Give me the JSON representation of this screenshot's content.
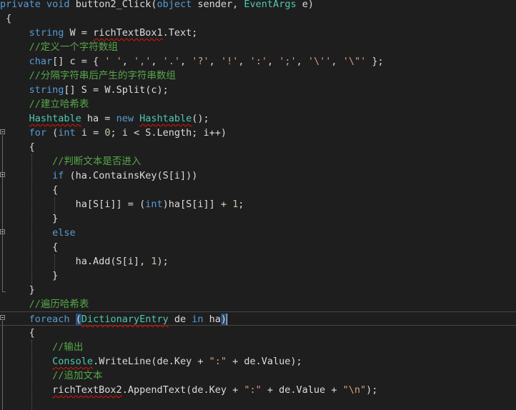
{
  "editor": {
    "theme": {
      "background": "#1e1e1e",
      "keyword": "#569cd6",
      "type": "#4ec9b0",
      "comment": "#57a64a",
      "string": "#d69d85",
      "number": "#b5cea8",
      "text": "#dcdcdc"
    },
    "lines": [
      [
        [
          "kw",
          "private"
        ],
        [
          "pl",
          " "
        ],
        [
          "kw",
          "void"
        ],
        [
          "pl",
          " button2_Click("
        ],
        [
          "kw",
          "object"
        ],
        [
          "pl",
          " sender, "
        ],
        [
          "ty",
          "EventArgs"
        ],
        [
          "pl",
          " e)"
        ]
      ],
      [
        [
          "pl",
          " {"
        ]
      ],
      [
        [
          "pl",
          "     "
        ],
        [
          "kw",
          "string"
        ],
        [
          "pl",
          " W = "
        ],
        [
          "pl",
          "richTextBox1",
          "sq"
        ],
        [
          "pl",
          ".Text;"
        ]
      ],
      [
        [
          "pl",
          "     "
        ],
        [
          "cm",
          "//定义一个字符数组"
        ]
      ],
      [
        [
          "pl",
          "     "
        ],
        [
          "kw",
          "char"
        ],
        [
          "pl",
          "[] c = { "
        ],
        [
          "st",
          "' '"
        ],
        [
          "pl",
          ", "
        ],
        [
          "st",
          "','"
        ],
        [
          "pl",
          ", "
        ],
        [
          "st",
          "'.'"
        ],
        [
          "pl",
          ", "
        ],
        [
          "st",
          "'?'"
        ],
        [
          "pl",
          ", "
        ],
        [
          "st",
          "'!'"
        ],
        [
          "pl",
          ", "
        ],
        [
          "st",
          "':'"
        ],
        [
          "pl",
          ", "
        ],
        [
          "st",
          "';'"
        ],
        [
          "pl",
          ", "
        ],
        [
          "st",
          "'\\''"
        ],
        [
          "pl",
          ", "
        ],
        [
          "st",
          "'\\\"'"
        ],
        [
          "pl",
          " };"
        ]
      ],
      [
        [
          "pl",
          "     "
        ],
        [
          "cm",
          "//分隔字符串后产生的字符串数组"
        ]
      ],
      [
        [
          "pl",
          "     "
        ],
        [
          "kw",
          "string"
        ],
        [
          "pl",
          "[] S = W.Split(c);"
        ]
      ],
      [
        [
          "pl",
          "     "
        ],
        [
          "cm",
          "//建立哈希表"
        ]
      ],
      [
        [
          "pl",
          "     "
        ],
        [
          "ty",
          "Hashtable",
          "sq"
        ],
        [
          "pl",
          " ha = "
        ],
        [
          "kw",
          "new"
        ],
        [
          "pl",
          " "
        ],
        [
          "ty",
          "Hashtable",
          "sq"
        ],
        [
          "pl",
          "();"
        ]
      ],
      [
        [
          "pl",
          "     "
        ],
        [
          "kw",
          "for"
        ],
        [
          "pl",
          " ("
        ],
        [
          "kw",
          "int"
        ],
        [
          "pl",
          " i = "
        ],
        [
          "nm",
          "0"
        ],
        [
          "pl",
          "; i < S.Length; i++)"
        ]
      ],
      [
        [
          "pl",
          "     {"
        ]
      ],
      [
        [
          "pl",
          "         "
        ],
        [
          "cm",
          "//判断文本是否进入"
        ]
      ],
      [
        [
          "pl",
          "         "
        ],
        [
          "kw",
          "if"
        ],
        [
          "pl",
          " (ha.ContainsKey(S[i]))"
        ]
      ],
      [
        [
          "pl",
          "         {"
        ]
      ],
      [
        [
          "pl",
          "             ha[S[i]] = ("
        ],
        [
          "kw",
          "int"
        ],
        [
          "pl",
          ")ha[S[i]] + "
        ],
        [
          "nm",
          "1"
        ],
        [
          "pl",
          ";"
        ]
      ],
      [
        [
          "pl",
          "         }"
        ]
      ],
      [
        [
          "pl",
          "         "
        ],
        [
          "kw",
          "else"
        ]
      ],
      [
        [
          "pl",
          "         {"
        ]
      ],
      [
        [
          "pl",
          "             ha.Add(S[i], "
        ],
        [
          "nm",
          "1"
        ],
        [
          "pl",
          ");"
        ]
      ],
      [
        [
          "pl",
          "         }"
        ]
      ],
      [
        [
          "pl",
          "     }"
        ]
      ],
      [
        [
          "pl",
          "     "
        ],
        [
          "cm",
          "//遍历哈希表"
        ]
      ],
      [
        [
          "pl",
          "     "
        ],
        [
          "kw",
          "foreach"
        ],
        [
          "pl",
          " "
        ],
        [
          "pl",
          "(",
          "hl"
        ],
        [
          "ty",
          "DictionaryEntry",
          "sq"
        ],
        [
          "pl",
          " de "
        ],
        [
          "kw",
          "in"
        ],
        [
          "pl",
          " ha"
        ],
        [
          "pl",
          ")",
          "hl"
        ]
      ],
      [
        [
          "pl",
          "     {"
        ]
      ],
      [
        [
          "pl",
          "         "
        ],
        [
          "cm",
          "//输出"
        ]
      ],
      [
        [
          "pl",
          "         "
        ],
        [
          "ty",
          "Console",
          "sq"
        ],
        [
          "pl",
          ".WriteLine(de.Key + "
        ],
        [
          "st",
          "\":\""
        ],
        [
          "pl",
          " + de.Value);"
        ]
      ],
      [
        [
          "pl",
          "         "
        ],
        [
          "cm",
          "//追加文本"
        ]
      ],
      [
        [
          "pl",
          "         "
        ],
        [
          "pl",
          "richTextBox2",
          "sq"
        ],
        [
          "pl",
          ".AppendText(de.Key + "
        ],
        [
          "st",
          "\":\""
        ],
        [
          "pl",
          " + de.Value + "
        ],
        [
          "st",
          "\"\\n\""
        ],
        [
          "pl",
          ");"
        ]
      ]
    ]
  }
}
